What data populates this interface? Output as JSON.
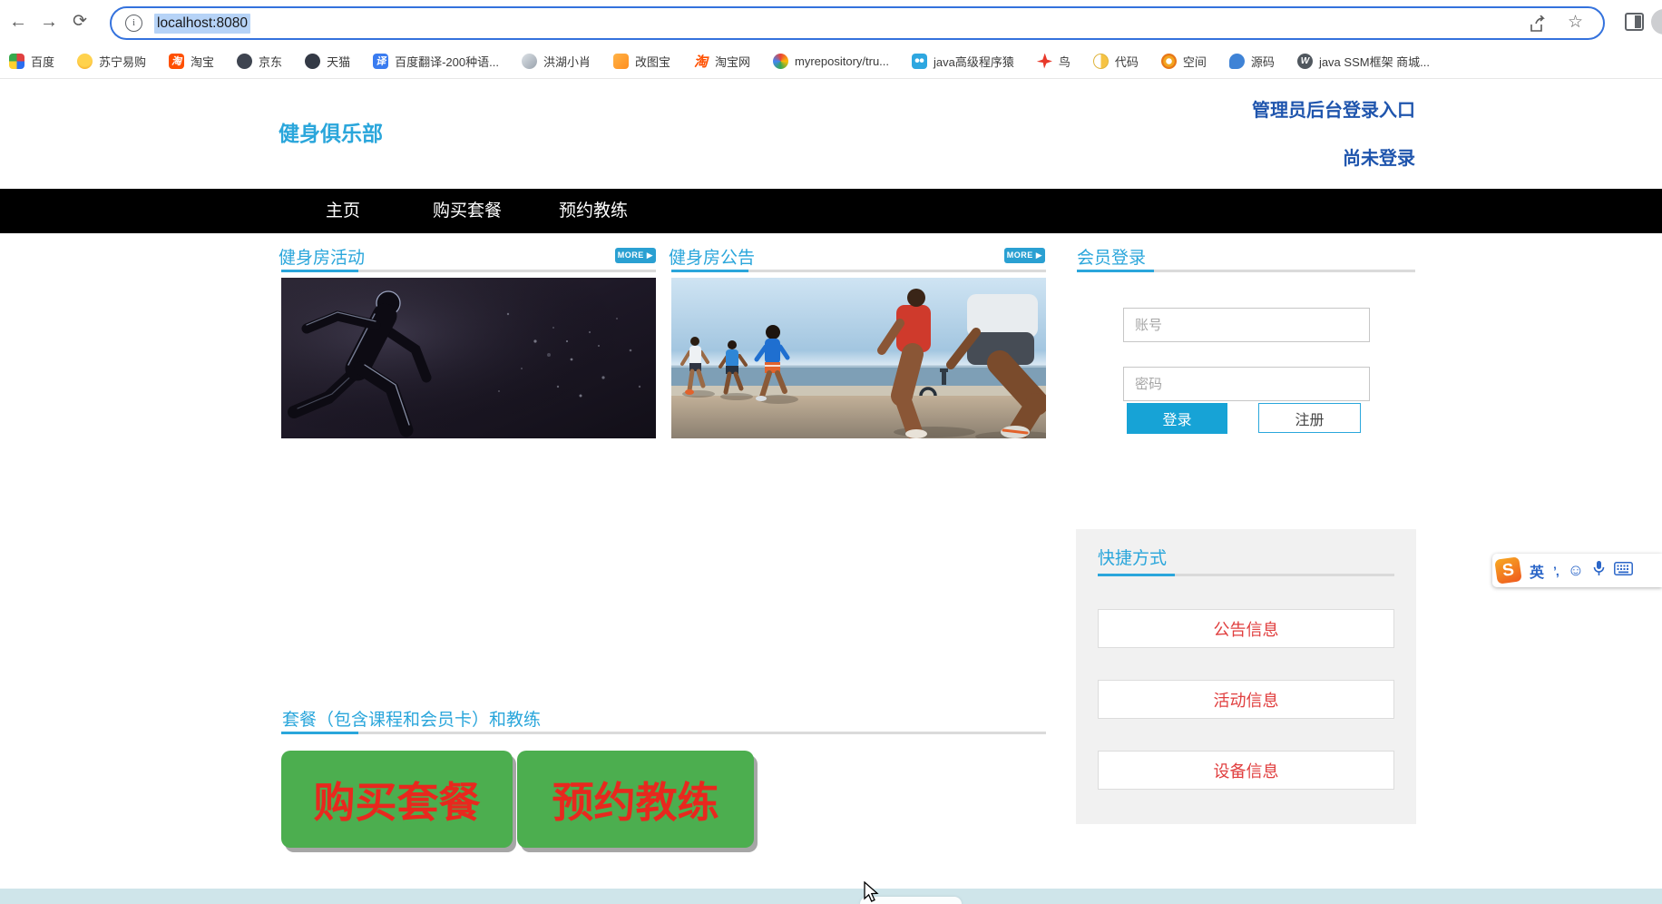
{
  "browser": {
    "url": "localhost:8080",
    "bookmarks": [
      {
        "label": "百度"
      },
      {
        "label": "苏宁易购"
      },
      {
        "label": "淘宝",
        "glyph": "淘"
      },
      {
        "label": "京东"
      },
      {
        "label": "天猫"
      },
      {
        "label": "百度翻译-200种语...",
        "glyph": "译"
      },
      {
        "label": "洪湖小肖"
      },
      {
        "label": "改图宝"
      },
      {
        "label": "淘宝网",
        "glyph": "淘"
      },
      {
        "label": "myrepository/tru..."
      },
      {
        "label": "java高级程序猿"
      },
      {
        "label": "鸟"
      },
      {
        "label": "代码"
      },
      {
        "label": "空间"
      },
      {
        "label": "源码"
      },
      {
        "label": "java SSM框架 商城...",
        "glyph": "W"
      }
    ]
  },
  "header": {
    "logo": "健身俱乐部",
    "admin_link": "管理员后台登录入口",
    "login_status": "尚未登录"
  },
  "nav": {
    "items": [
      {
        "label": "主页"
      },
      {
        "label": "购买套餐"
      },
      {
        "label": "预约教练"
      }
    ]
  },
  "activity": {
    "title": "健身房活动",
    "more": "MORE ▶"
  },
  "notice": {
    "title": "健身房公告",
    "more": "MORE ▶"
  },
  "member_login": {
    "title": "会员登录",
    "account_placeholder": "账号",
    "password_placeholder": "密码",
    "login_label": "登录",
    "register_label": "注册"
  },
  "shortcuts": {
    "title": "快捷方式",
    "items": [
      {
        "label": "公告信息"
      },
      {
        "label": "活动信息"
      },
      {
        "label": "设备信息"
      }
    ]
  },
  "packages": {
    "title": "套餐（包含课程和会员卡）和教练",
    "buy_label": "购买套餐",
    "book_label": "预约教练"
  },
  "ime": {
    "mode": "英",
    "punct": "’,",
    "emoji": "☺"
  },
  "colors": {
    "accent_blue": "#2aa6db",
    "link_blue": "#1f55ad",
    "nav_bg": "#000000",
    "button_green": "#4cae4f",
    "button_text_red": "#e8281e",
    "shortcut_text_red": "#e03e3e",
    "footer_teal": "#cfe5ea",
    "url_selection": "#b6d3f7"
  }
}
